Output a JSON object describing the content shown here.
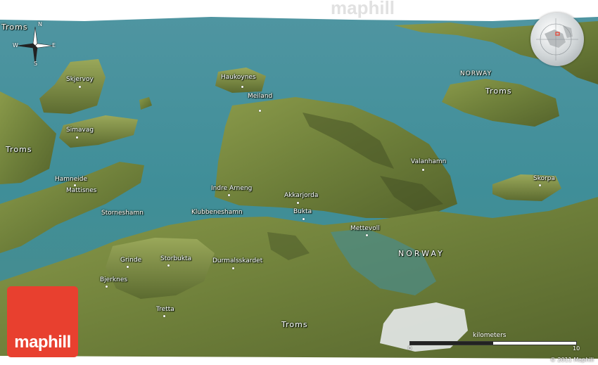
{
  "map": {
    "watermark": "maphill",
    "logo_text": "maphill",
    "copyright": "© 2011 Maphill",
    "colors": {
      "water": "#3f8e98",
      "land": "#6e7f3a",
      "logo": "#e8402f"
    },
    "compass": {
      "n": "N",
      "s": "S",
      "e": "E",
      "w": "W"
    },
    "scale": {
      "title": "kilometers",
      "min": "0",
      "max": "10"
    },
    "labels": {
      "troms_nw": "Troms",
      "norway_ne": "NORWAY",
      "troms_ne": "Troms",
      "skjervoy": "Skjervoy",
      "haukoynes": "Haukoynes",
      "meiland": "Meiland",
      "simavag": "Simavag",
      "troms_w": "Troms",
      "valanhamn": "Valanhamn",
      "skorpa": "Skorpa",
      "hamneide": "Hamneide",
      "mattisnes": "Mattisnes",
      "indre_arneng": "Indre Arneng",
      "akkarjorda": "Akkarjorda",
      "storneshamn": "Storneshamn",
      "klubbeneshamn": "Klubbeneshamn",
      "bukta": "Bukta",
      "mettevoll": "Mettevoll",
      "norway_center": "NORWAY",
      "grinde": "Grinde",
      "storbukta": "Storbukta",
      "durmalsskardet": "Durmalsskardet",
      "bjerknes": "Bjerknes",
      "tretta": "Tretta",
      "troms_s": "Troms"
    }
  }
}
